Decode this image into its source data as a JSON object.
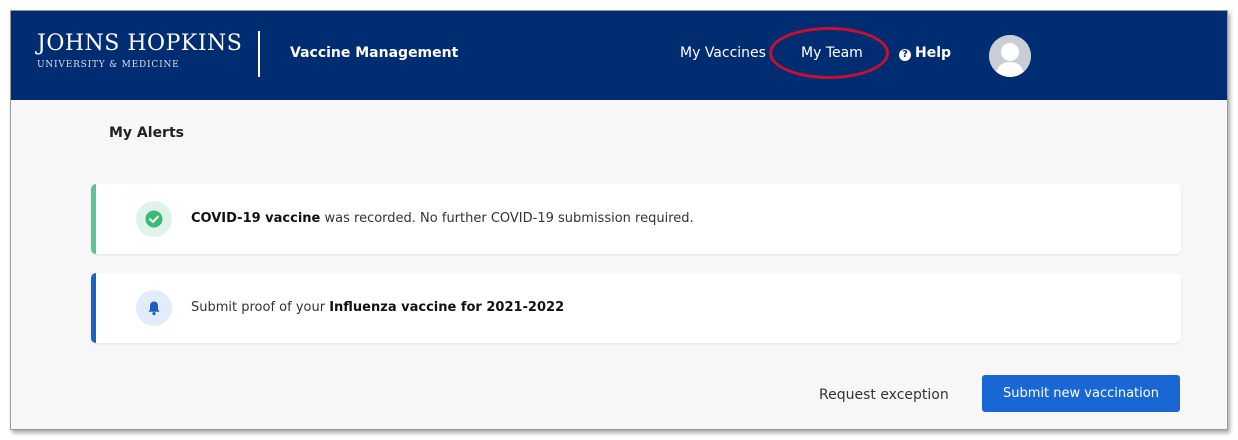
{
  "header": {
    "logo_main": "JOHNS HOPKINS",
    "logo_sub": "UNIVERSITY & MEDICINE",
    "app_title": "Vaccine Management",
    "nav": {
      "my_vaccines": "My Vaccines",
      "my_team": "My Team",
      "help": "Help"
    },
    "colors": {
      "navbar": "#002d72",
      "highlight": "#c8102e"
    }
  },
  "alerts": {
    "heading": "My Alerts",
    "items": [
      {
        "icon": "check-circle-icon",
        "accent": "#5cc593",
        "bold": "COVID-19 vaccine",
        "text": " was recorded. No further COVID-19 submission required."
      },
      {
        "icon": "bell-icon",
        "accent": "#1a5fc4",
        "prefix": "Submit proof of your ",
        "bold": "Influenza vaccine for 2021-2022"
      }
    ]
  },
  "actions": {
    "request_exception": "Request exception",
    "submit_new": "Submit new vaccination",
    "primary_color": "#1967d2"
  }
}
